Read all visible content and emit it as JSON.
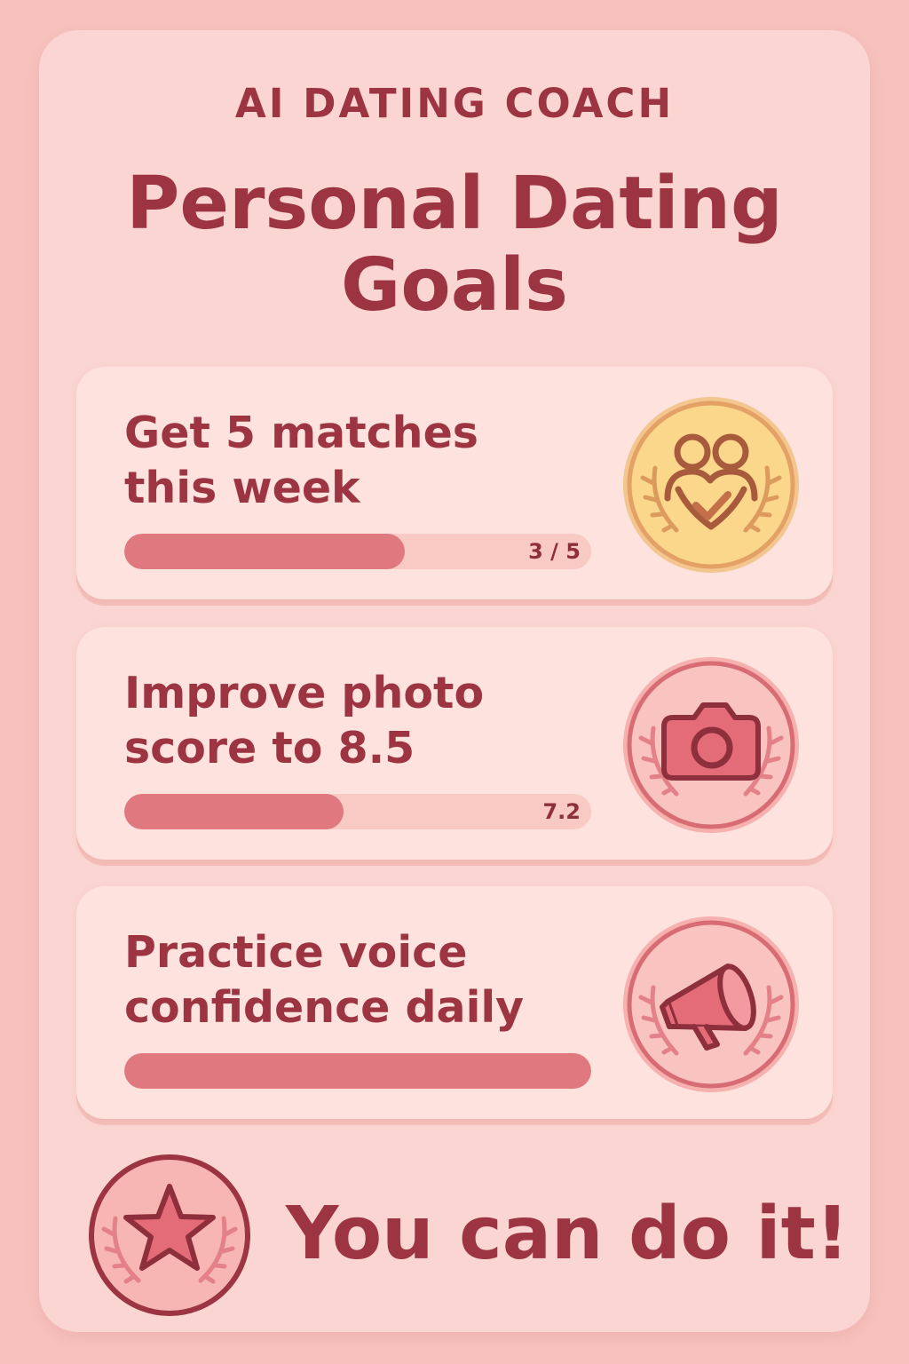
{
  "header": {
    "eyebrow": "AI DATING COACH",
    "title": "Personal Dating Goals"
  },
  "goals": [
    {
      "title": "Get 5 matches\nthis week",
      "progress_text": "3 / 5",
      "progress_value": 3,
      "progress_max": 5,
      "icon": "couple-heart-check-icon",
      "badge_style": "gold"
    },
    {
      "title": "Improve photo\nscore to 8.5",
      "progress_text": "7.2",
      "progress_value": 0.47,
      "progress_max": 1,
      "icon": "camera-icon",
      "badge_style": "pink"
    },
    {
      "title": "Practice voice\nconfidence daily",
      "progress_value": 1,
      "progress_max": 1,
      "icon": "megaphone-icon",
      "badge_style": "pink"
    }
  ],
  "footer": {
    "icon": "star-icon",
    "message": "You can do it!"
  },
  "colors": {
    "background": "#f7c2bd",
    "panel": "#fbd5d1",
    "card": "#fde2de",
    "accent_text": "#9c3442",
    "progress_fill": "#e0797f",
    "progress_track": "#f9c9c4",
    "gold_badge": "#fbd78c",
    "pink_badge": "#f7b5b3"
  }
}
